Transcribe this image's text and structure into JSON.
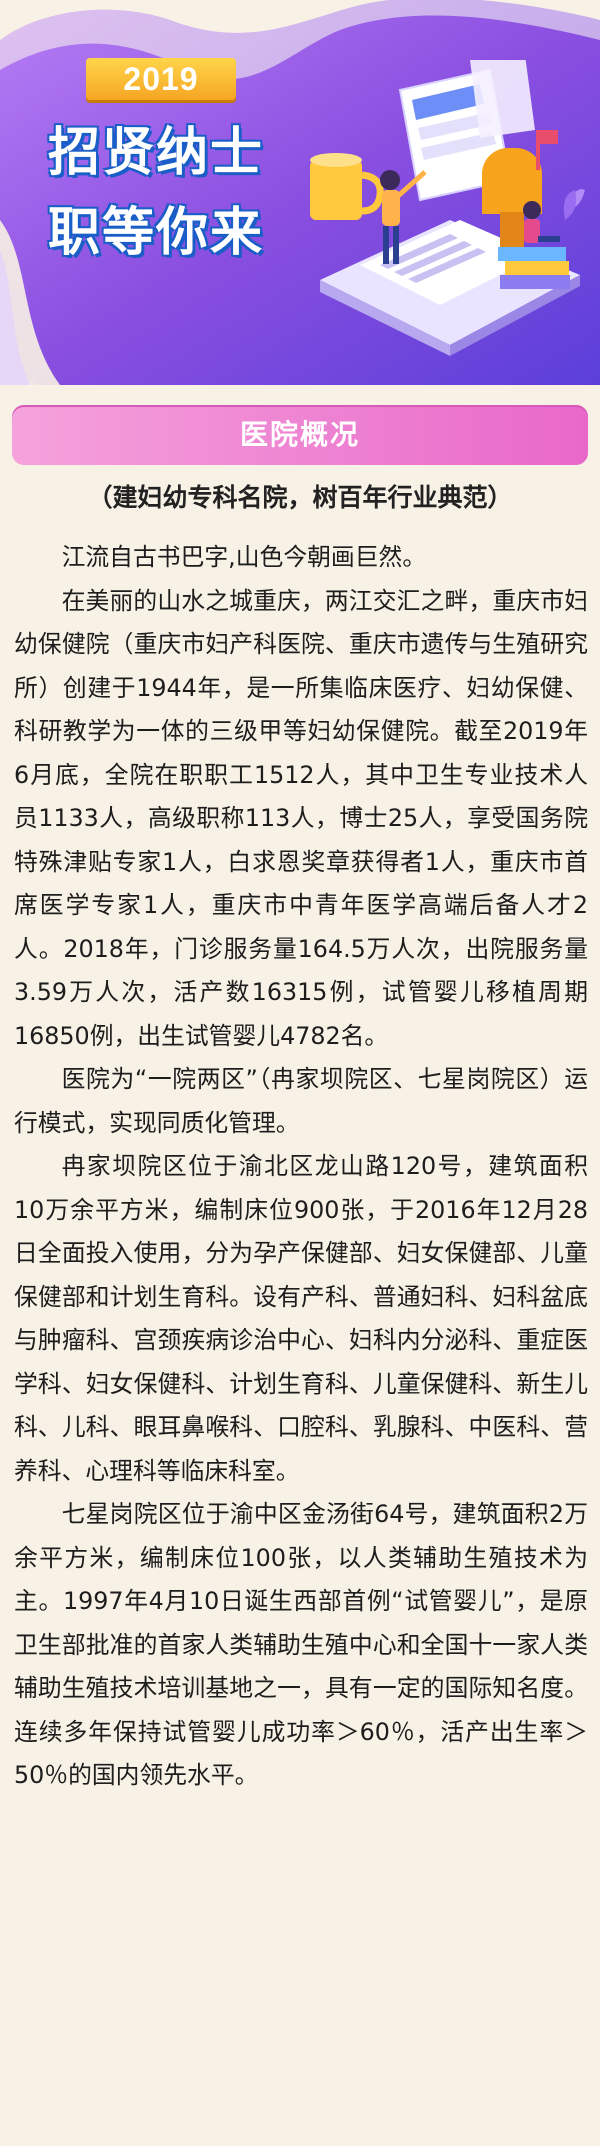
{
  "hero": {
    "year": "2019",
    "title_line1": "招贤纳士",
    "title_line2": "职等你来",
    "illustration": "office-desk-illustration"
  },
  "section": {
    "title": "医院概况",
    "subtitle": "（建妇幼专科名院，树百年行业典范）"
  },
  "paragraphs": [
    "江流自古书巴字,山色今朝画巨然。",
    "在美丽的山水之城重庆，两江交汇之畔，重庆市妇幼保健院（重庆市妇产科医院、重庆市遗传与生殖研究所）创建于1944年，是一所集临床医疗、妇幼保健、科研教学为一体的三级甲等妇幼保健院。截至2019年6月底，全院在职职工1512人，其中卫生专业技术人员1133人，高级职称113人，博士25人，享受国务院特殊津贴专家1人，白求恩奖章获得者1人，重庆市首席医学专家1人，重庆市中青年医学高端后备人才2人。2018年，门诊服务量164.5万人次，出院服务量3.59万人次，活产数16315例，试管婴儿移植周期16850例，出生试管婴儿4782名。",
    "医院为“一院两区”（冉家坝院区、七星岗院区）运行模式，实现同质化管理。",
    "冉家坝院区位于渝北区龙山路120号，建筑面积10万余平方米，编制床位900张，于2016年12月28日全面投入使用，分为孕产保健部、妇女保健部、儿童保健部和计划生育科。设有产科、普通妇科、妇科盆底与肿瘤科、宫颈疾病诊治中心、妇科内分泌科、重症医学科、妇女保健科、计划生育科、儿童保健科、新生儿科、儿科、眼耳鼻喉科、口腔科、乳腺科、中医科、营养科、心理科等临床科室。",
    "七星岗院区位于渝中区金汤街64号，建筑面积2万余平方米，编制床位100张，以人类辅助生殖技术为主。1997年4月10日诞生西部首例“试管婴儿”，是原卫生部批准的首家人类辅助生殖中心和全国十一家人类辅助生殖技术培训基地之一，具有一定的国际知名度。连续多年保持试管婴儿成功率＞60％，活产出生率＞50％的国内领先水平。"
  ],
  "colors": {
    "page_bg": "#f8f2e6",
    "banner_purple": "#8a4fe0",
    "section_pink": "#e868c9",
    "badge_orange": "#f6a623"
  }
}
